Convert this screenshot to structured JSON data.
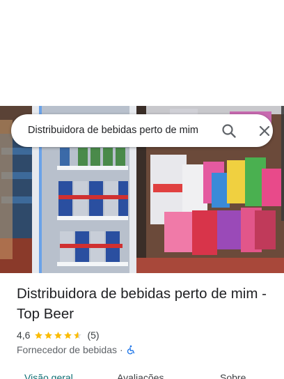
{
  "search": {
    "query": "Distribuidora de bebidas perto de mim",
    "search_icon": "search-icon",
    "close_icon": "close-icon"
  },
  "place": {
    "title": "Distribuidora de bebidas perto de mim - Top Beer",
    "rating": "4,6",
    "stars": 4.6,
    "review_count": "(5)",
    "category": "Fornecedor de bebidas",
    "separator": "·",
    "accessibility_icon": "wheelchair-accessible-icon"
  },
  "tabs": [
    {
      "label": "Visão geral",
      "active": true
    },
    {
      "label": "Avaliações",
      "active": false
    },
    {
      "label": "Sobre",
      "active": false
    }
  ],
  "colors": {
    "accent": "#0b6e73",
    "star": "#fbbc04",
    "accessibility": "#1a73e8"
  }
}
